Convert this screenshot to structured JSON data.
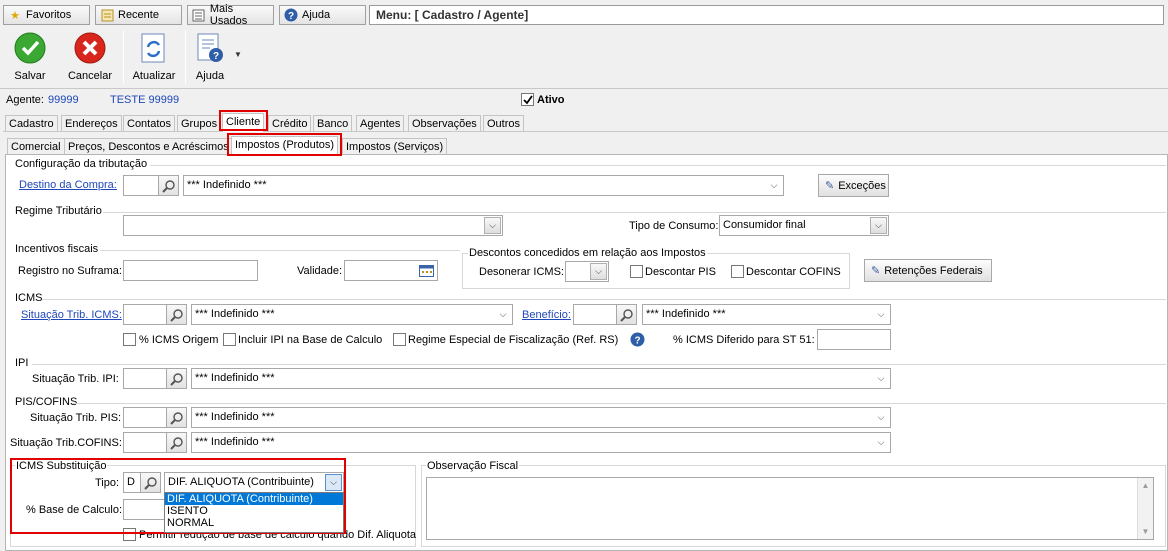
{
  "topbar": {
    "favoritos": "Favoritos",
    "recente": "Recente",
    "mais_usados": "Mais Usados",
    "ajuda": "Ajuda",
    "menu_path": "Menu: [ Cadastro / Agente]"
  },
  "toolbar": {
    "salvar": "Salvar",
    "cancelar": "Cancelar",
    "atualizar": "Atualizar",
    "ajuda": "Ajuda"
  },
  "agent": {
    "label": "Agente:",
    "code": "99999",
    "name": "TESTE 99999",
    "ativo_label": "Ativo",
    "ativo_checked": true
  },
  "main_tabs": [
    "Cadastro",
    "Endereços",
    "Contatos",
    "Grupos",
    "Cliente",
    "Crédito",
    "Banco",
    "Agentes",
    "Observações",
    "Outros"
  ],
  "sub_tabs": [
    "Comercial",
    "Preços, Descontos e Acréscimos",
    "Impostos (Produtos)",
    "Impostos (Serviços)"
  ],
  "config": {
    "title": "Configuração da tributação",
    "destino_label": "Destino da Compra:",
    "destino_value": "*** Indefinido ***",
    "excecoes": "Exceções"
  },
  "regime": {
    "title": "Regime Tributário",
    "tipo_consumo_label": "Tipo de Consumo:",
    "tipo_consumo_value": "Consumidor final"
  },
  "incentivos": {
    "title": "Incentivos fiscais",
    "suframa_label": "Registro no Suframa:",
    "validade_label": "Validade:"
  },
  "descontos": {
    "title": "Descontos concedidos em relação aos Impostos",
    "desonerar_label": "Desonerar ICMS:",
    "pis_label": "Descontar PIS",
    "cofins_label": "Descontar COFINS",
    "retencoes": "Retenções Federais"
  },
  "icms": {
    "title": "ICMS",
    "sit_label": "Situação Trib. ICMS:",
    "sit_value": "*** Indefinido ***",
    "beneficio_label": "Benefício:",
    "beneficio_value": "*** Indefinido ***",
    "origem_label": "% ICMS Origem",
    "ipi_base_label": "Incluir IPI na Base de Calculo",
    "regime_esp_label": "Regime Especial de Fiscalização (Ref. RS)",
    "diferido_label": "% ICMS Diferido para ST 51:"
  },
  "ipi": {
    "title": "IPI",
    "sit_label": "Situação Trib. IPI:",
    "sit_value": "*** Indefinido ***"
  },
  "piscofins": {
    "title": "PIS/COFINS",
    "pis_label": "Situação Trib. PIS:",
    "pis_value": "*** Indefinido ***",
    "cofins_label": "Situação Trib.COFINS:",
    "cofins_value": "*** Indefinido ***"
  },
  "icms_st": {
    "title": "ICMS Substituição",
    "tipo_label": "Tipo:",
    "tipo_code": "D",
    "tipo_value": "DIF. ALIQUOTA (Contribuinte)",
    "options": [
      "DIF. ALIQUOTA (Contribuinte)",
      "ISENTO",
      "NORMAL"
    ],
    "base_label": "% Base de Calculo:",
    "permitir_label": "Permitir redução de base de calculo quando Dif. Aliquota"
  },
  "obs": {
    "title": "Observação Fiscal"
  },
  "colors": {
    "highlight_red": "#e00000",
    "link_blue": "#1f47b8",
    "agent_blue": "#1f47b8",
    "selection_blue": "#0078d7"
  }
}
